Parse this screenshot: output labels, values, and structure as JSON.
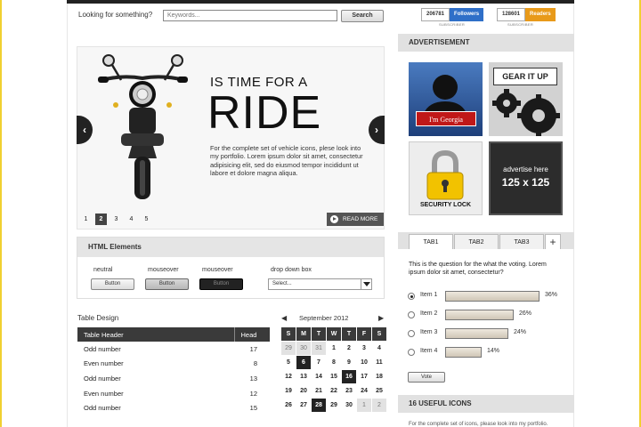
{
  "search": {
    "label": "Looking for something?",
    "placeholder": "Keywords...",
    "button": "Search"
  },
  "counters": {
    "followers": {
      "value": "206781",
      "label": "Followers",
      "sub": "SUBSCRIBER",
      "color": "#2f6fc8"
    },
    "readers": {
      "value": "128601",
      "label": "Readers",
      "sub": "SUBSCRIBER",
      "color": "#e89a1a"
    }
  },
  "slider": {
    "kicker": "IS TIME FOR A",
    "title": "RIDE",
    "body": "For the complete set of vehicle icons, plese look into my portfolio. Lorem ipsum dolor sit amet, consectetur adipisicing elit, sed do eiusmod tempor incididunt ut labore et dolore magna aliqua.",
    "pages": [
      "1",
      "2",
      "3",
      "4",
      "5"
    ],
    "active_page": "2",
    "read_more": "READ MORE"
  },
  "elements": {
    "title": "HTML Elements",
    "neutral_label": "neutral",
    "mouseover_label": "mouseover",
    "mousedown_label": "mouseover",
    "button_label": "Button",
    "dropdown_label": "drop down box",
    "dropdown_value": "Select..."
  },
  "table": {
    "title": "Table Design",
    "headers": [
      "Table Header",
      "Head"
    ],
    "rows": [
      [
        "Odd number",
        "17"
      ],
      [
        "Even number",
        "8"
      ],
      [
        "Odd number",
        "13"
      ],
      [
        "Even number",
        "12"
      ],
      [
        "Odd number",
        "15"
      ]
    ]
  },
  "calendar": {
    "month": "September 2012",
    "days": [
      "S",
      "M",
      "T",
      "W",
      "T",
      "F",
      "S"
    ],
    "cells": [
      {
        "d": "29",
        "s": "muted"
      },
      {
        "d": "30",
        "s": "muted"
      },
      {
        "d": "31",
        "s": "muted"
      },
      {
        "d": "1",
        "s": ""
      },
      {
        "d": "2",
        "s": ""
      },
      {
        "d": "3",
        "s": ""
      },
      {
        "d": "4",
        "s": ""
      },
      {
        "d": "5",
        "s": ""
      },
      {
        "d": "6",
        "s": "sel"
      },
      {
        "d": "7",
        "s": ""
      },
      {
        "d": "8",
        "s": ""
      },
      {
        "d": "9",
        "s": ""
      },
      {
        "d": "10",
        "s": ""
      },
      {
        "d": "11",
        "s": ""
      },
      {
        "d": "12",
        "s": ""
      },
      {
        "d": "13",
        "s": ""
      },
      {
        "d": "14",
        "s": ""
      },
      {
        "d": "15",
        "s": ""
      },
      {
        "d": "16",
        "s": "sel"
      },
      {
        "d": "17",
        "s": ""
      },
      {
        "d": "18",
        "s": ""
      },
      {
        "d": "19",
        "s": ""
      },
      {
        "d": "20",
        "s": ""
      },
      {
        "d": "21",
        "s": ""
      },
      {
        "d": "22",
        "s": ""
      },
      {
        "d": "23",
        "s": ""
      },
      {
        "d": "24",
        "s": ""
      },
      {
        "d": "25",
        "s": ""
      },
      {
        "d": "26",
        "s": ""
      },
      {
        "d": "27",
        "s": ""
      },
      {
        "d": "28",
        "s": "sel"
      },
      {
        "d": "29",
        "s": ""
      },
      {
        "d": "30",
        "s": ""
      },
      {
        "d": "1",
        "s": "muted"
      },
      {
        "d": "2",
        "s": "muted"
      }
    ]
  },
  "advertisement": {
    "title": "ADVERTISEMENT",
    "georgia": "I'm Georgia",
    "gear": "GEAR IT UP",
    "security": "SECURITY LOCK",
    "advertise": "advertise here",
    "size": "125 x 125"
  },
  "tabs": {
    "labels": [
      "TAB1",
      "TAB2",
      "TAB3"
    ],
    "plus": "+"
  },
  "poll": {
    "question": "This is the question for the what the voting. Lorem ipsum dolor sit amet, consectetur?",
    "items": [
      {
        "label": "Item 1",
        "pct": "36%",
        "value": 36,
        "selected": true
      },
      {
        "label": "Item 2",
        "pct": "26%",
        "value": 26,
        "selected": false
      },
      {
        "label": "Item 3",
        "pct": "24%",
        "value": 24,
        "selected": false
      },
      {
        "label": "Item 4",
        "pct": "14%",
        "value": 14,
        "selected": false
      }
    ],
    "vote": "Vote"
  },
  "useful": {
    "title": "16 USEFUL ICONS",
    "body": "For the complete set of icons, please look into my portfolio."
  }
}
